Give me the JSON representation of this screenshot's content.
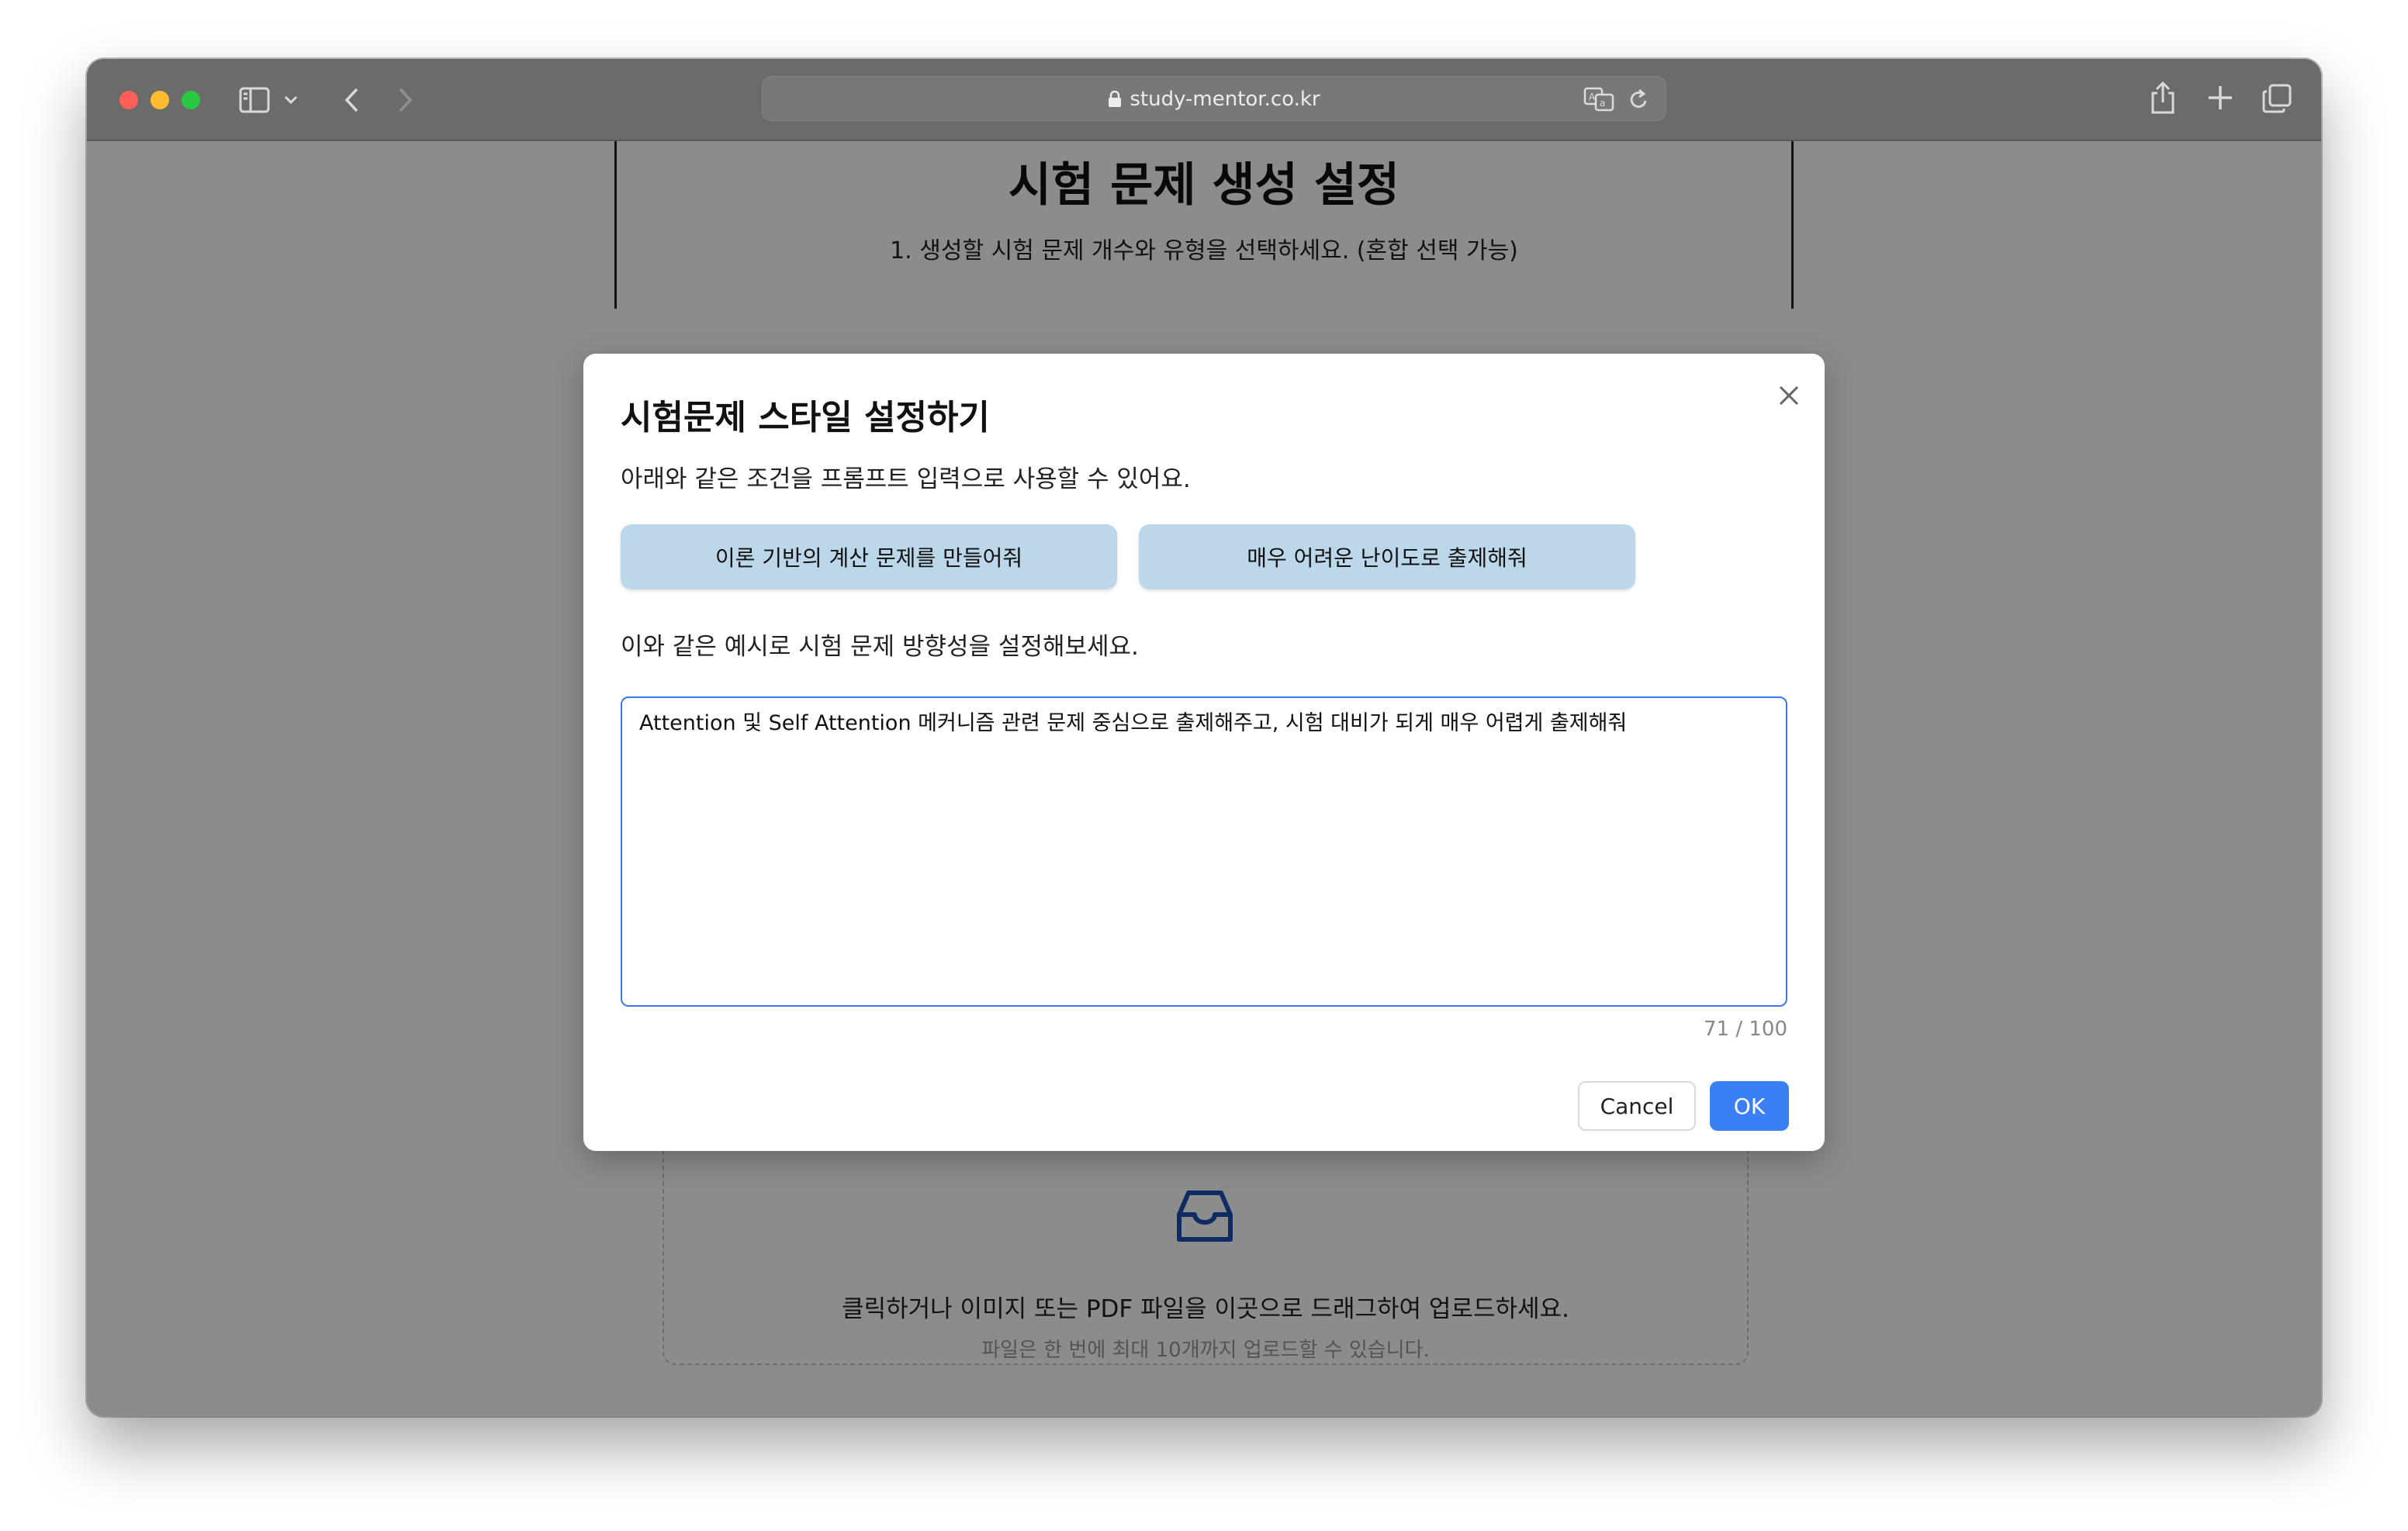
{
  "browser": {
    "url": "study-mentor.co.kr",
    "icons": [
      "sidebar-icon",
      "chevron-down-icon",
      "back-icon",
      "forward-icon",
      "lock-icon",
      "translate-icon",
      "reload-icon",
      "share-icon",
      "new-tab-icon",
      "tab-overview-icon"
    ]
  },
  "page": {
    "title": "시험 문제 생성 설정",
    "subtitle": "1. 생성할 시험 문제 개수와 유형을 선택하세요. (혼합 선택 가능)",
    "upload": {
      "icon": "inbox-icon",
      "text": "클릭하거나 이미지 또는 PDF 파일을 이곳으로 드래그하여 업로드하세요.",
      "hint": "파일은 한 번에 최대 10개까지 업로드할 수 있습니다."
    }
  },
  "modal": {
    "title": "시험문제 스타일 설정하기",
    "description": "아래와 같은 조건을 프롬프트 입력으로 사용할 수 있어요.",
    "presets": [
      {
        "label": "이론 기반의 계산 문제를 만들어줘"
      },
      {
        "label": "매우 어려운 난이도로 출제해줘"
      }
    ],
    "example_text": "이와 같은 예시로 시험 문제 방향성을 설정해보세요.",
    "prompt_value": "Attention 및 Self Attention 메커니즘 관련 문제 중심으로 출제해주고, 시험 대비가 되게 매우 어렵게 출제해줘",
    "counter": "71 / 100",
    "cancel_label": "Cancel",
    "ok_label": "OK"
  },
  "colors": {
    "accent": "#3b7ff5",
    "preset_button_bg": "#bcd6ea",
    "upload_icon": "#1e4fb5"
  }
}
